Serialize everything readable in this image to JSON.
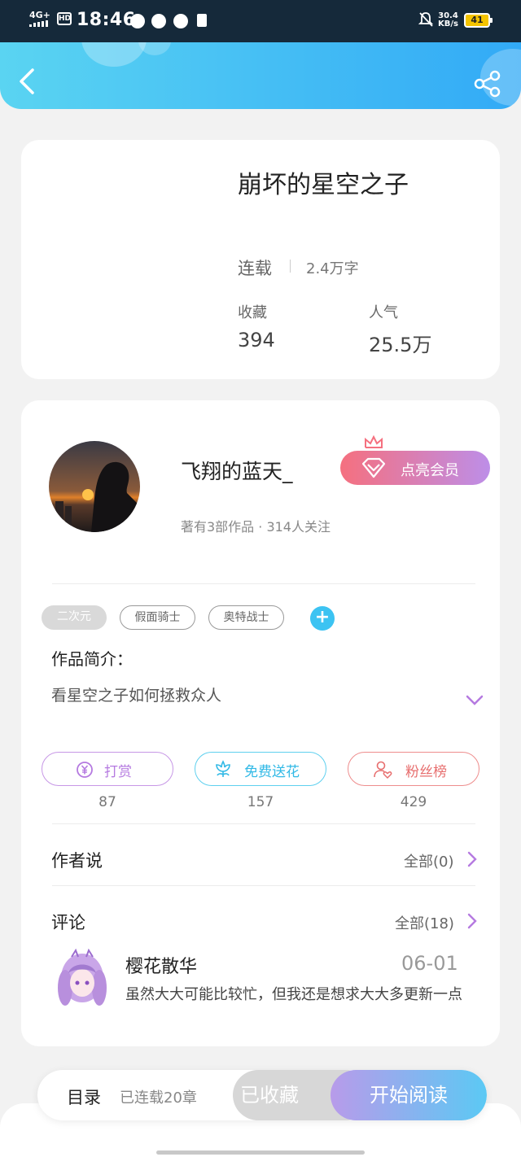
{
  "status_bar": {
    "network": "4G+",
    "hd": "HD",
    "time": "18:46",
    "speed_value": "30.4",
    "speed_unit": "KB/s",
    "battery": "41"
  },
  "header": {
    "back_icon": "chevron-left-icon",
    "share_icon": "share-icon"
  },
  "book": {
    "title": "崩坏的星空之子",
    "status": "连载",
    "word_count": "2.4万字",
    "favorites_label": "收藏",
    "favorites_value": "394",
    "popularity_label": "人气",
    "popularity_value": "25.5万"
  },
  "author": {
    "name": "飞翔的蓝天_",
    "meta": "著有3部作品 · 314人关注",
    "vip_label": "点亮会员"
  },
  "tags": [
    "二次元",
    "假面骑士",
    "奥特战士"
  ],
  "intro": {
    "title": "作品简介：",
    "text": "看星空之子如何拯救众人"
  },
  "actions": {
    "reward": {
      "label": "打赏",
      "count": "87"
    },
    "flower": {
      "label": "免费送花",
      "count": "157"
    },
    "fans": {
      "label": "粉丝榜",
      "count": "429"
    }
  },
  "author_says": {
    "title": "作者说",
    "link": "全部(0)"
  },
  "comments": {
    "title": "评论",
    "link": "全部(18)",
    "items": [
      {
        "user": "樱花散华",
        "date": "06-01",
        "text": "虽然大大可能比较忙，但我还是想求大大多更新一点"
      }
    ]
  },
  "bottom_bar": {
    "toc": "目录",
    "toc_sub": "已连载20章",
    "collected": "已收藏",
    "read": "开始阅读"
  },
  "colors": {
    "header_start": "#5ad4f2",
    "header_end": "#32aaf6",
    "vip_start": "#f5707f",
    "vip_end": "#bd8ee8",
    "accent_blue": "#3cc3f2",
    "reward": "#b57ae0",
    "flower": "#31b9e6",
    "fans": "#e76e6e"
  }
}
